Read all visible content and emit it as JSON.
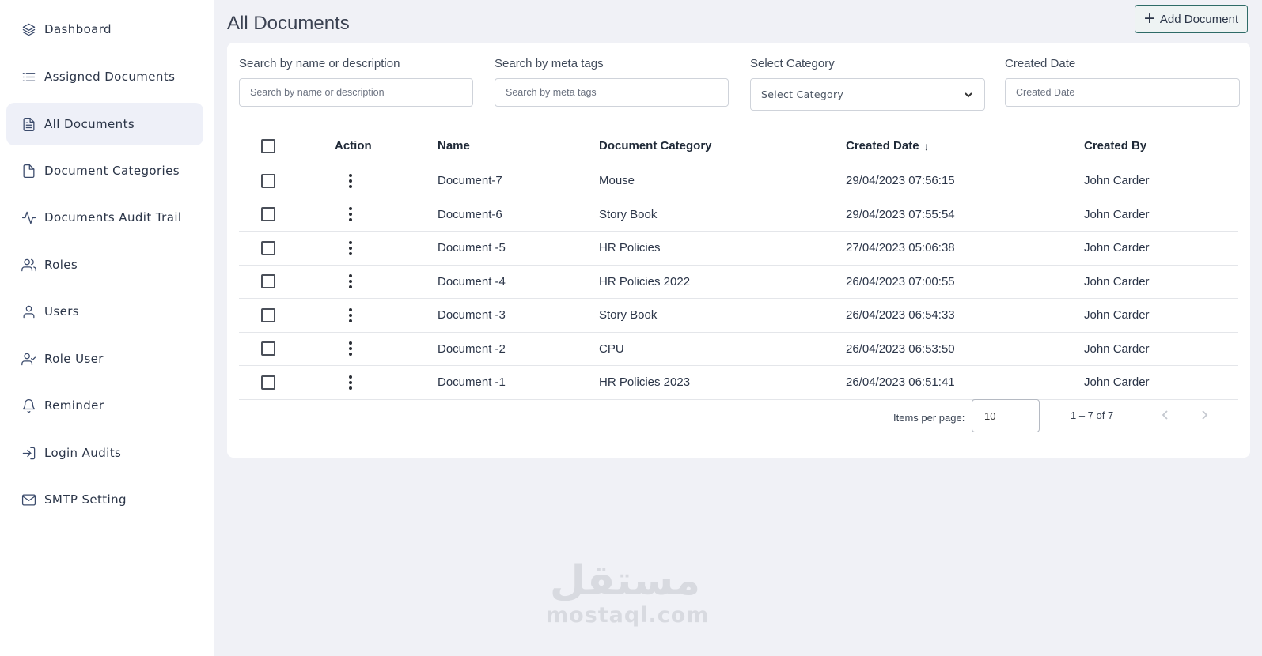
{
  "sidebar": {
    "items": [
      {
        "label": "Dashboard",
        "icon": "layers-icon"
      },
      {
        "label": "Assigned Documents",
        "icon": "list-icon"
      },
      {
        "label": "All Documents",
        "icon": "document-text-icon",
        "active": true
      },
      {
        "label": "Document Categories",
        "icon": "file-icon"
      },
      {
        "label": "Documents Audit Trail",
        "icon": "activity-icon"
      },
      {
        "label": "Roles",
        "icon": "users-icon"
      },
      {
        "label": "Users",
        "icon": "user-icon"
      },
      {
        "label": "Role User",
        "icon": "user-check-icon"
      },
      {
        "label": "Reminder",
        "icon": "bell-icon"
      },
      {
        "label": "Login Audits",
        "icon": "log-in-icon"
      },
      {
        "label": "SMTP Setting",
        "icon": "mail-icon"
      }
    ]
  },
  "header": {
    "title": "All Documents",
    "add_button": "Add Document"
  },
  "filters": {
    "name": {
      "label": "Search by name or description",
      "placeholder": "Search by name or description",
      "value": ""
    },
    "tags": {
      "label": "Search by meta tags",
      "placeholder": "Search by meta tags",
      "value": ""
    },
    "category": {
      "label": "Select Category",
      "placeholder": "Select Category"
    },
    "date": {
      "label": "Created Date",
      "placeholder": "Created Date",
      "value": ""
    }
  },
  "table": {
    "columns": {
      "action": "Action",
      "name": "Name",
      "category": "Document Category",
      "created_date": "Created Date",
      "created_by": "Created By"
    },
    "sort_indicator": "↓",
    "rows": [
      {
        "name": "Document-7",
        "category": "Mouse",
        "created_date": "29/04/2023 07:56:15",
        "created_by": "John Carder"
      },
      {
        "name": "Document-6",
        "category": "Story Book",
        "created_date": "29/04/2023 07:55:54",
        "created_by": "John Carder"
      },
      {
        "name": "Document -5",
        "category": "HR Policies",
        "created_date": "27/04/2023 05:06:38",
        "created_by": "John Carder"
      },
      {
        "name": "Document -4",
        "category": "HR Policies 2022",
        "created_date": "26/04/2023 07:00:55",
        "created_by": "John Carder"
      },
      {
        "name": "Document -3",
        "category": "Story Book",
        "created_date": "26/04/2023 06:54:33",
        "created_by": "John Carder"
      },
      {
        "name": "Document -2",
        "category": "CPU",
        "created_date": "26/04/2023 06:53:50",
        "created_by": "John Carder"
      },
      {
        "name": "Document -1",
        "category": "HR Policies 2023",
        "created_date": "26/04/2023 06:51:41",
        "created_by": "John Carder"
      }
    ]
  },
  "paginator": {
    "items_per_page_label": "Items per page:",
    "items_per_page_value": "10",
    "range_label": "1 – 7 of 7"
  },
  "watermark": {
    "arabic": "مستقل",
    "latin": "mostaql.com"
  }
}
